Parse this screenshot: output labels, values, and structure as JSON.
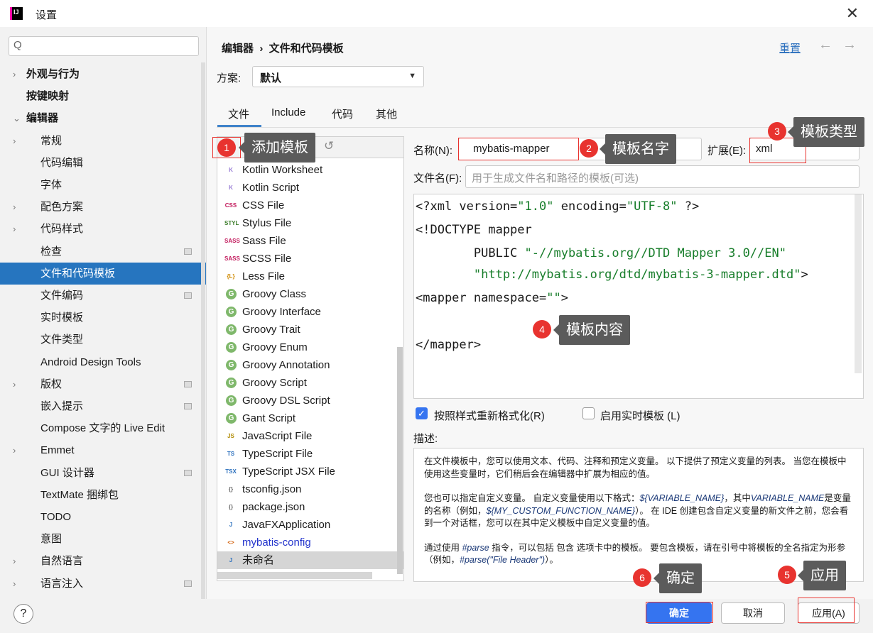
{
  "window": {
    "title": "设置",
    "app_icon": "IJ"
  },
  "sidebar": {
    "search_placeholder": "Q",
    "items": [
      {
        "label": "外观与行为",
        "chev": ">",
        "bold": true,
        "indent": 0
      },
      {
        "label": "按键映射",
        "bold": true,
        "indent": 0
      },
      {
        "label": "编辑器",
        "chev": "v",
        "bold": true,
        "indent": 0
      },
      {
        "label": "常规",
        "chev": ">",
        "indent": 1
      },
      {
        "label": "代码编辑",
        "indent": 1
      },
      {
        "label": "字体",
        "indent": 1
      },
      {
        "label": "配色方案",
        "chev": ">",
        "indent": 1
      },
      {
        "label": "代码样式",
        "chev": ">",
        "indent": 1
      },
      {
        "label": "检查",
        "indent": 1,
        "page": true
      },
      {
        "label": "文件和代码模板",
        "indent": 1,
        "selected": true
      },
      {
        "label": "文件编码",
        "indent": 1,
        "page": true
      },
      {
        "label": "实时模板",
        "indent": 1
      },
      {
        "label": "文件类型",
        "indent": 1
      },
      {
        "label": "Android Design Tools",
        "indent": 1
      },
      {
        "label": "版权",
        "chev": ">",
        "indent": 1,
        "page": true
      },
      {
        "label": "嵌入提示",
        "indent": 1,
        "page": true
      },
      {
        "label": "Compose 文字的 Live Edit",
        "indent": 1
      },
      {
        "label": "Emmet",
        "chev": ">",
        "indent": 1
      },
      {
        "label": "GUI 设计器",
        "indent": 1,
        "page": true
      },
      {
        "label": "TextMate 捆绑包",
        "indent": 1
      },
      {
        "label": "TODO",
        "indent": 1
      },
      {
        "label": "意图",
        "indent": 1
      },
      {
        "label": "自然语言",
        "chev": ">",
        "indent": 1
      },
      {
        "label": "语言注入",
        "chev": ">",
        "indent": 1,
        "page": true
      }
    ]
  },
  "header": {
    "breadcrumb": "编辑器  ›  文件和代码模板",
    "reset": "重置",
    "back": "←",
    "forward": "→"
  },
  "scheme": {
    "label": "方案:",
    "value": "默认"
  },
  "tabs": [
    {
      "label": "文件",
      "active": true
    },
    {
      "label": "Include"
    },
    {
      "label": "代码"
    },
    {
      "label": "其他"
    }
  ],
  "templates": [
    {
      "name": "Kotlin Worksheet",
      "icon": "K",
      "color": "#9a7fd6"
    },
    {
      "name": "Kotlin Script",
      "icon": "K",
      "color": "#9a7fd6"
    },
    {
      "name": "CSS File",
      "icon": "CSS",
      "color": "#c2185b"
    },
    {
      "name": "Stylus File",
      "icon": "STYL",
      "color": "#3b7d2a"
    },
    {
      "name": "Sass File",
      "icon": "SASS",
      "color": "#c2185b"
    },
    {
      "name": "SCSS File",
      "icon": "SASS",
      "color": "#c2185b"
    },
    {
      "name": "Less File",
      "icon": "{L}",
      "color": "#d08a00"
    },
    {
      "name": "Groovy Class",
      "icon": "G",
      "groovy": true
    },
    {
      "name": "Groovy Interface",
      "icon": "G",
      "groovy": true
    },
    {
      "name": "Groovy Trait",
      "icon": "G",
      "groovy": true
    },
    {
      "name": "Groovy Enum",
      "icon": "G",
      "groovy": true
    },
    {
      "name": "Groovy Annotation",
      "icon": "G",
      "groovy": true
    },
    {
      "name": "Groovy Script",
      "icon": "G",
      "groovy": true
    },
    {
      "name": "Groovy DSL Script",
      "icon": "G",
      "groovy": true
    },
    {
      "name": "Gant Script",
      "icon": "G",
      "groovy": true
    },
    {
      "name": "JavaScript File",
      "icon": "JS",
      "color": "#b08a00"
    },
    {
      "name": "TypeScript File",
      "icon": "TS",
      "color": "#2a6fbd"
    },
    {
      "name": "TypeScript JSX File",
      "icon": "TSX",
      "color": "#2a6fbd"
    },
    {
      "name": "tsconfig.json",
      "icon": "{}",
      "color": "#666"
    },
    {
      "name": "package.json",
      "icon": "{}",
      "color": "#666"
    },
    {
      "name": "JavaFXApplication",
      "icon": "J",
      "color": "#2a6fbd"
    },
    {
      "name": "mybatis-config",
      "icon": "<>",
      "color": "#d05a00",
      "link": true
    },
    {
      "name": "未命名",
      "icon": "J",
      "color": "#2a6fbd",
      "selected": true
    }
  ],
  "form": {
    "name_label": "名称(N):",
    "name_value": "mybatis-mapper",
    "ext_label": "扩展(E):",
    "ext_value": "xml",
    "filename_label": "文件名(F):",
    "filename_placeholder": "用于生成文件名和路径的模板(可选)"
  },
  "editor": {
    "lines": [
      [
        {
          "t": "<?xml version="
        },
        {
          "t": "\"1.0\"",
          "s": 1
        },
        {
          "t": " encoding="
        },
        {
          "t": "\"UTF-8\"",
          "s": 1
        },
        {
          "t": " ?>"
        }
      ],
      [
        {
          "t": "<!DOCTYPE mapper"
        }
      ],
      [
        {
          "t": "        PUBLIC "
        },
        {
          "t": "\"-//mybatis.org//DTD Mapper 3.0//EN\"",
          "s": 1
        }
      ],
      [
        {
          "t": "        "
        },
        {
          "t": "\"http://mybatis.org/dtd/mybatis-3-mapper.dtd\"",
          "s": 1
        },
        {
          "t": ">"
        }
      ],
      [
        {
          "t": "<mapper namespace="
        },
        {
          "t": "\"\"",
          "s": 1
        },
        {
          "t": ">"
        }
      ],
      [
        {
          "t": ""
        }
      ],
      [
        {
          "t": "</mapper>"
        }
      ]
    ]
  },
  "options": {
    "reformat": "按照样式重新格式化(R)",
    "reformat_checked": true,
    "live_templates": "启用实时模板 (L)",
    "live_checked": false
  },
  "description": {
    "label": "描述:",
    "p1": "在文件模板中，您可以使用文本、代码、注释和预定义变量。 以下提供了预定义变量的列表。 当您在模板中使用这些变量时，它们稍后会在编辑器中扩展为相应的值。",
    "p2a": "您也可以指定自定义变量。 自定义变量使用以下格式：",
    "p2v1": "${VARIABLE_NAME}",
    "p2b": "，其中",
    "p2v2": "VARIABLE_NAME",
    "p2c": "是变量的名称（例如，",
    "p2v3": "${MY_CUSTOM_FUNCTION_NAME}",
    "p2d": "）。 在 IDE 创建包含自定义变量的新文件之前，您会看到一个对话框，您可以在其中定义模板中自定义变量的值。",
    "p3a": "通过使用 ",
    "p3v1": "#parse",
    "p3b": " 指令，可以包括 包含 选项卡中的模板。 要包含模板，请在引号中将模板的全名指定为形参（例如，",
    "p3v2": "#parse(\"File Header\")",
    "p3c": "）。"
  },
  "buttons": {
    "ok": "确定",
    "cancel": "取消",
    "apply": "应用(A)",
    "help": "?"
  },
  "annotations": [
    {
      "n": "1",
      "text": "添加模板"
    },
    {
      "n": "2",
      "text": "模板名字"
    },
    {
      "n": "3",
      "text": "模板类型"
    },
    {
      "n": "4",
      "text": "模板内容"
    },
    {
      "n": "5",
      "text": "应用"
    },
    {
      "n": "6",
      "text": "确定"
    }
  ],
  "colors": {
    "accent": "#2675bf",
    "annotation_red": "#e8332f",
    "tooltip": "#5b5b5b",
    "code_string": "#177d2a"
  }
}
